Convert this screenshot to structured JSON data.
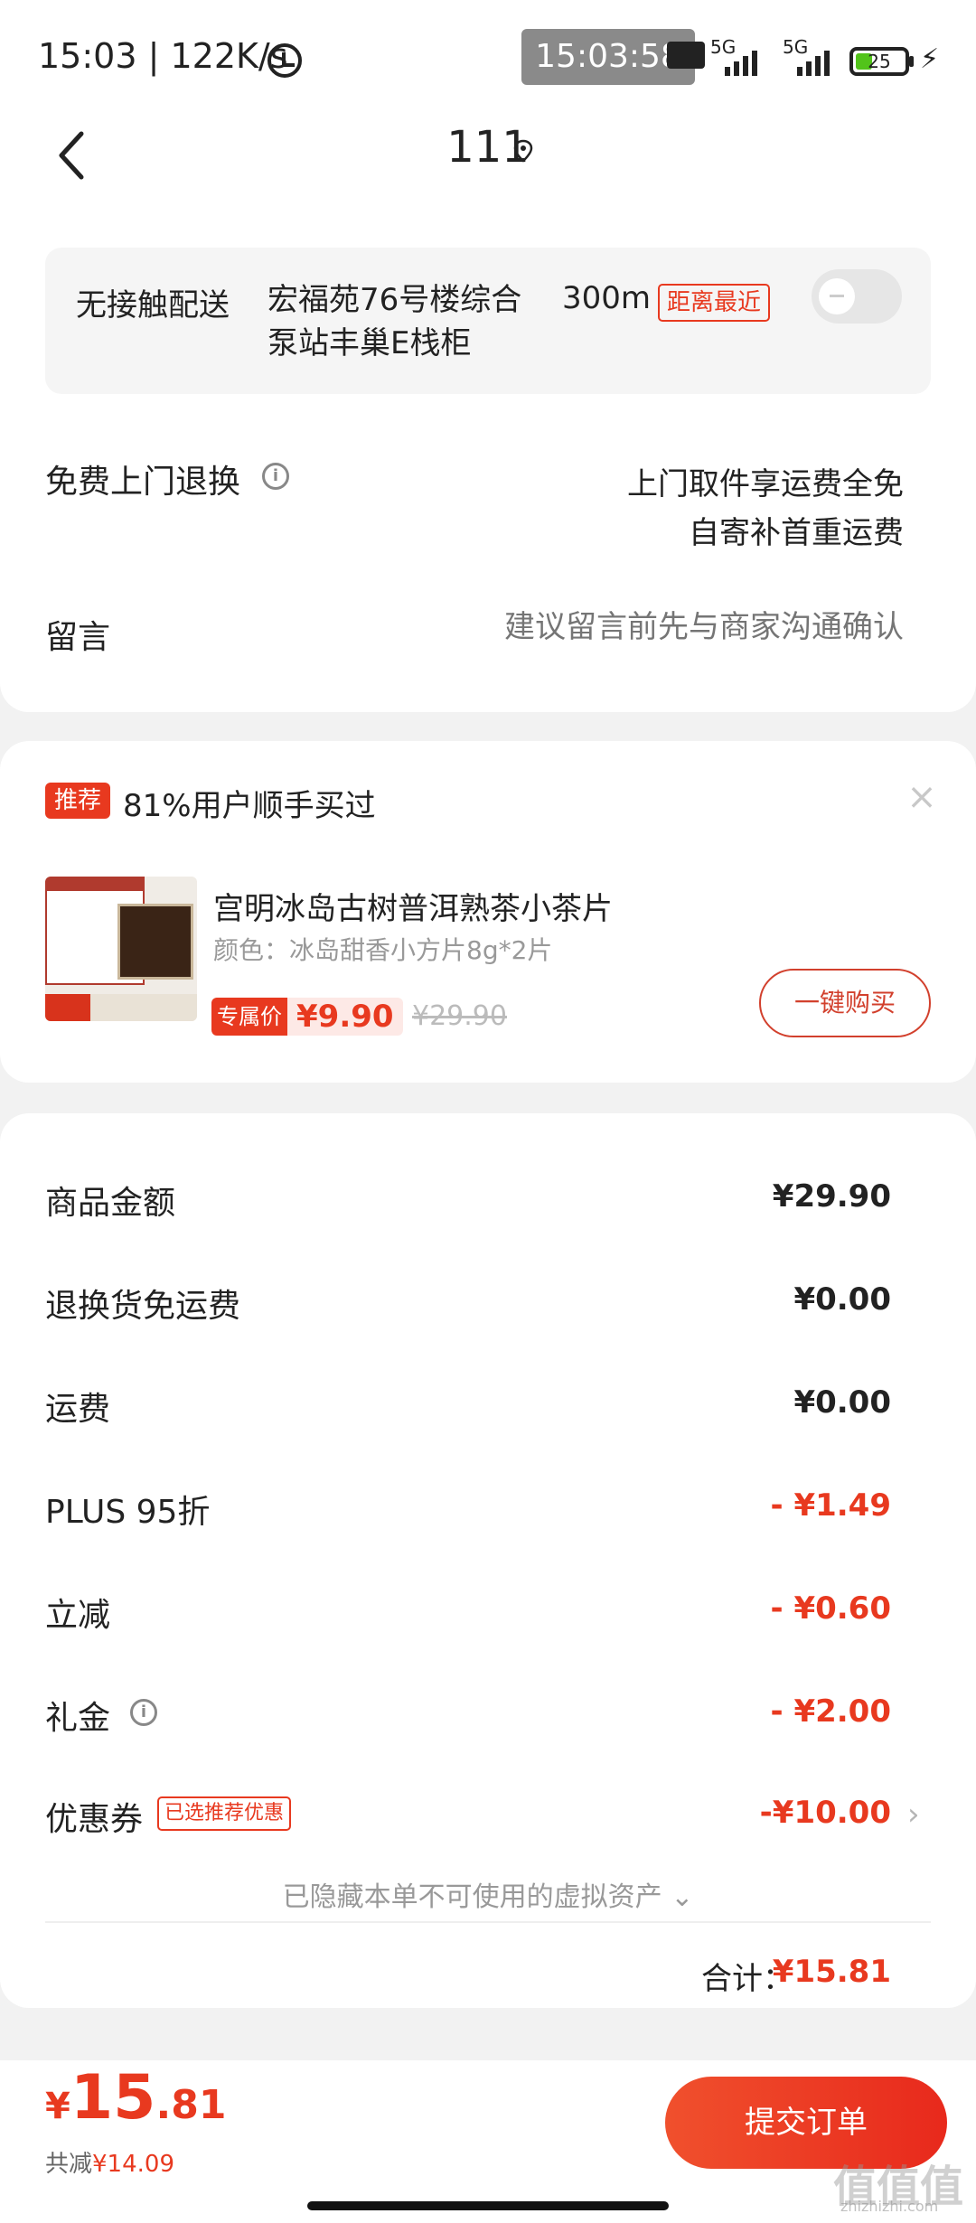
{
  "status_bar": {
    "time": "15:03 | 122K/s",
    "overlay_clock": "15:03:58",
    "network1": "5G",
    "network2": "5G",
    "battery": "25"
  },
  "nav": {
    "title": "111"
  },
  "delivery": {
    "label": "无接触配送",
    "locker": "宏福苑76号楼综合泵站丰巢E栈柜",
    "distance": "300m",
    "nearest_badge": "距离最近"
  },
  "returns": {
    "label": "免费上门退换",
    "line1": "上门取件享运费全免",
    "line2": "自寄补首重运费"
  },
  "note": {
    "label": "留言",
    "placeholder": "建议留言前先与商家沟通确认"
  },
  "recommend": {
    "badge": "推荐",
    "text": "81%用户顺手买过",
    "product_title": "宫明冰岛古树普洱熟茶小茶片",
    "product_color": "颜色：冰岛甜香小方片8g*2片",
    "exclusive_label": "专属价",
    "exclusive_price": "¥9.90",
    "original_price": "¥29.90",
    "buy_button": "一键购买"
  },
  "summary": {
    "rows": [
      {
        "label": "商品金额",
        "value": "¥29.90"
      },
      {
        "label": "退换货免运费",
        "value": "¥0.00"
      },
      {
        "label": "运费",
        "value": "¥0.00"
      },
      {
        "label": "PLUS 95折",
        "value": "- ¥1.49"
      },
      {
        "label": "立减",
        "value": "- ¥0.60"
      },
      {
        "label": "礼金",
        "value": "- ¥2.00"
      },
      {
        "label": "优惠券",
        "value": "-¥10.00"
      }
    ],
    "coupon_badge": "已选推荐优惠",
    "hidden_assets": "已隐藏本单不可使用的虚拟资产 ⌄",
    "total_label": "合计：",
    "total_value": "¥15.81"
  },
  "bottom": {
    "yen": "¥",
    "price_int": "15",
    "price_dec": ".81",
    "saved_label": "共减",
    "saved_value": "¥14.09",
    "submit": "提交订单"
  },
  "watermark": {
    "text": "值值值",
    "sub": "zhizhizhi.com"
  },
  "colors": {
    "accent": "#e8391f",
    "background": "#f2f2f2"
  }
}
